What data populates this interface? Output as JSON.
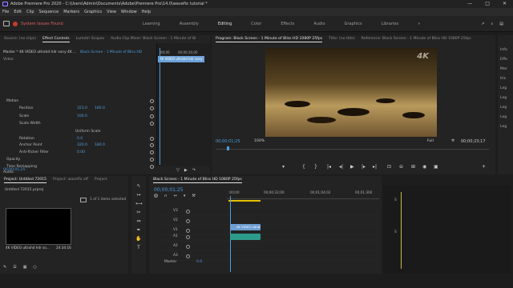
{
  "window": {
    "title": "Adobe Premiere Pro 2020 - C:\\Users\\Admin\\Documents\\Adobe\\Premiere Pro\\14.0\\wavefix tutorial *",
    "min": "—",
    "max": "□",
    "close": "✕"
  },
  "menu": [
    "File",
    "Edit",
    "Clip",
    "Sequence",
    "Markers",
    "Graphics",
    "View",
    "Window",
    "Help"
  ],
  "header": {
    "issues": "System Issues Found",
    "workspaces": [
      "Learning",
      "Assembly",
      "Editing",
      "Color",
      "Effects",
      "Audio",
      "Graphics",
      "Libraries"
    ],
    "active_workspace": "Editing",
    "more": "»"
  },
  "source_panel": {
    "tabs": [
      "Source: (no clips)",
      "Effect Controls",
      "Lumetri Scopes",
      "Audio Clip Mixer: Black Screen - 1 Minute of Bl"
    ],
    "master": "Master * 4K VIDEO ultrahd hdr sony 4K ...",
    "clip_ref": "Black Screen - 1 Minute of Bliss HD",
    "mini_times": [
      "00;00",
      "00;00;16;00"
    ],
    "mini_clip": "4K VIDEO ultrahd hdr sony",
    "video_label": "Video",
    "rows": [
      {
        "label": "Motion",
        "fx": true
      },
      {
        "label": "Position",
        "v1": "323.0",
        "v2": "180.0"
      },
      {
        "label": "Scale",
        "v1": "100.0"
      },
      {
        "label": "Scale Width",
        "v1": ""
      },
      {
        "label": "Uniform Scale",
        "checkbox": true
      },
      {
        "label": "Rotation",
        "v1": "0.0"
      },
      {
        "label": "Anchor Point",
        "v1": "320.0",
        "v2": "180.0"
      },
      {
        "label": "Anti-flicker Filter",
        "v1": "0.00"
      },
      {
        "label": "Opacity",
        "fx": true
      },
      {
        "label": "Time Remapping",
        "fx": true
      },
      {
        "label": "Audio",
        "header": true
      },
      {
        "label": "Volume",
        "fx": true
      },
      {
        "label": "Channel Volume",
        "fx": true
      },
      {
        "label": "Panner",
        "fx": true
      }
    ],
    "timecode": "00;00;01;25"
  },
  "program_panel": {
    "tabs": [
      "Program: Black Screen - 1 Minute of Bliss HD 1080P 25fps",
      "Title: (no title)",
      "Reference: Black Screen - 1 Minute of Bliss HD 1080P 25fps"
    ],
    "watermark": "4K",
    "timecode": "00;00;01;25",
    "zoom": "100%",
    "quality": "Full",
    "duration": "00;00;23;17",
    "controls": [
      "▾",
      "{",
      "}",
      "|◂",
      "◂|",
      "▶",
      "|▸",
      "▸|",
      "⊡",
      "⊖",
      "⊞",
      "◉",
      "▣",
      "+"
    ]
  },
  "right_sidebar": [
    "Info",
    "Effe",
    "Mar",
    "His",
    "Leg",
    "Leg",
    "Leg",
    "Leg",
    "Leg"
  ],
  "project_panel": {
    "tabs": [
      "Project: Untitled 72015",
      "Project: wavefix off",
      "Project"
    ],
    "file": "Untitled 72015.prproj",
    "selection": "1 of 1 items selected",
    "clip_name": "4K VIDEO ultrahd hdr so...",
    "clip_duration": "24:34:16"
  },
  "timeline": {
    "tab": "Black Screen - 1 Minute of Bliss HD 1080P 25fps",
    "timecode": "00;00;01;25",
    "ruler": [
      ":00;00",
      "00;00;32;00",
      "00;01;04;02",
      "00;01;360"
    ],
    "video_tracks": [
      "V3",
      "V2",
      "V1"
    ],
    "audio_tracks": [
      "A1",
      "A2",
      "A3"
    ],
    "master": "Master",
    "master_val": "0.0",
    "video_clip": "4K VIDEO ultrahd"
  },
  "audio_meter": {
    "labels": [
      "S",
      "S"
    ]
  }
}
